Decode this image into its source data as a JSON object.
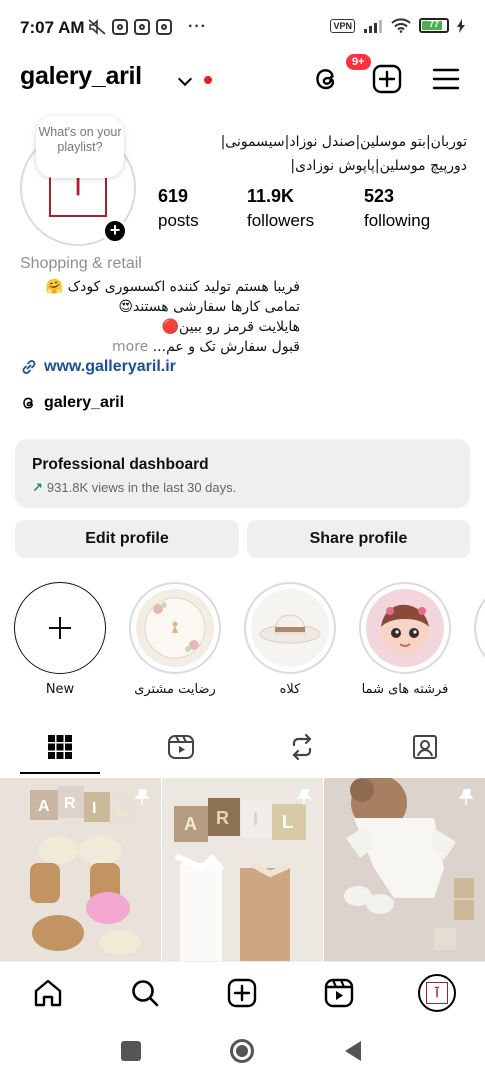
{
  "status_bar": {
    "time": "7:07 AM",
    "vpn": "VPN",
    "battery": "77"
  },
  "header": {
    "username": "galery_aril",
    "threads_badge": "9+"
  },
  "profile": {
    "note": "What's on your playlist?",
    "display_name_lines": [
      "توربان|بتو موسلین|صندل نوزاد|سیسمونی|",
      "دورپیچ موسلین|پاپوش نوزادی|"
    ],
    "stats": [
      {
        "value": "619",
        "label": "posts"
      },
      {
        "value": "11.9K",
        "label": "followers"
      },
      {
        "value": "523",
        "label": "following"
      }
    ],
    "category": "Shopping & retail",
    "bio_lines": [
      "فریبا هستم تولید کننده اکسسوری کودک 🤗",
      "تمامی کارها سفارشی هستند😍",
      "هایلایت قرمز رو ببین🔴"
    ],
    "bio_last": "قبول سفارش تک و عم...",
    "bio_more": "more",
    "link": "www.galleryaril.ir",
    "threads_handle": "galery_aril"
  },
  "dashboard": {
    "title": "Professional dashboard",
    "subtitle": "931.8K views in the last 30 days."
  },
  "buttons": {
    "edit": "Edit profile",
    "share": "Share profile"
  },
  "highlights": [
    {
      "label": "New"
    },
    {
      "label": "رضایت مشتری"
    },
    {
      "label": "کلاه"
    },
    {
      "label": "فرشته های شما"
    }
  ],
  "colors": {
    "accent_red": "#ed1c24",
    "link_blue": "#1a4f9c",
    "card_bg": "#efefef"
  }
}
